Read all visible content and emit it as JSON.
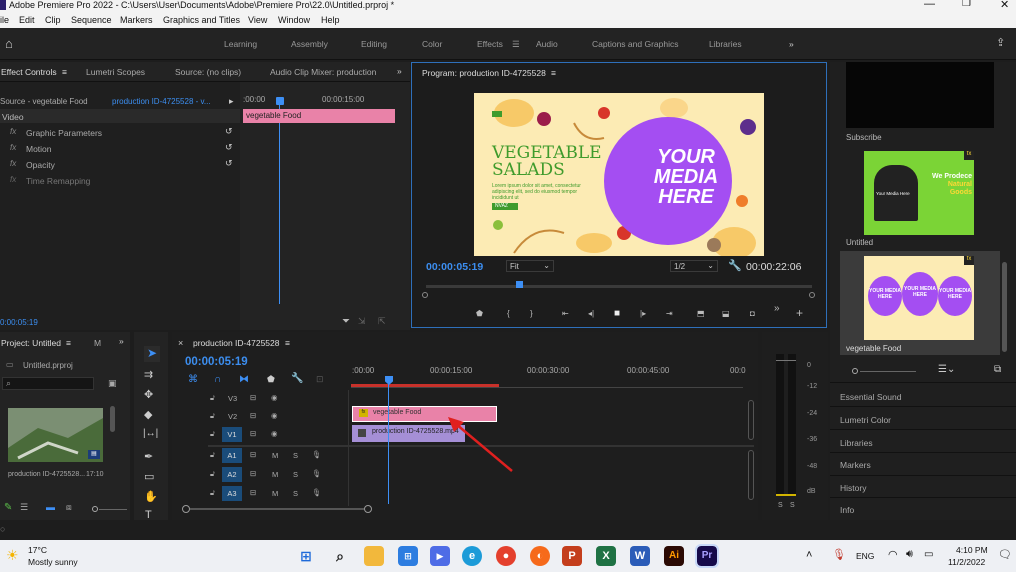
{
  "window": {
    "title": "Adobe Premiere Pro 2022 - C:\\Users\\User\\Documents\\Adobe\\Premiere Pro\\22.0\\Untitled.prproj *"
  },
  "menu": [
    "ile",
    "Edit",
    "Clip",
    "Sequence",
    "Markers",
    "Graphics and Titles",
    "View",
    "Window",
    "Help"
  ],
  "workspaces": [
    "Learning",
    "Assembly",
    "Editing",
    "Color",
    "Effects",
    "Audio",
    "Captions and Graphics",
    "Libraries"
  ],
  "active_workspace": "Effects",
  "effect_controls": {
    "tabs": [
      "Effect Controls",
      "Lumetri Scopes",
      "Source: (no clips)",
      "Audio Clip Mixer: production"
    ],
    "source": "Source - vegetable Food",
    "sequence": "production ID-4725528 - v...",
    "video_label": "Video",
    "effects": [
      "Graphic Parameters",
      "Motion",
      "Opacity",
      "Time Remapping"
    ],
    "times": [
      ":00:00",
      "00:00:15:00"
    ],
    "clip_label": "vegetable Food",
    "current_time": "0:00:05:19"
  },
  "program": {
    "title": "Program: production ID-4725528",
    "timecode": "00:00:05:19",
    "fit": "Fit",
    "resolution": "1/2",
    "duration": "00:00:22:06",
    "preview": {
      "headline1": "VEGETABLE",
      "headline2": "SALADS",
      "body": "Lorem ipsum dolor sit amet, consectetur adipiscing elit, sed do eiusmod tempor incididunt ut",
      "cta": "NVAZ",
      "media": [
        "YOUR",
        "MEDIA",
        "HERE"
      ]
    }
  },
  "templates": {
    "items": [
      "Subscribe",
      "Untitled",
      "vegetable Food"
    ],
    "thumb2_text": [
      "We Prodece",
      "Natural",
      "Goods"
    ],
    "thumb2_sub": "Your Media Here",
    "thumb3_bubbles": [
      "YOUR MEDIA HERE",
      "YOUR MEDIA HERE",
      "YOUR MEDIA HERE"
    ],
    "panels": [
      "Essential Sound",
      "Lumetri Color",
      "Libraries",
      "Markers",
      "History",
      "Info"
    ]
  },
  "project": {
    "title": "Project: Untitled",
    "m": "M",
    "file": "Untitled.prproj",
    "clip_name": "production ID-4725528...",
    "clip_duration": "17:10"
  },
  "timeline": {
    "title": "production ID-4725528",
    "timecode": "00:00:05:19",
    "ruler": [
      ":00:00",
      "00:00:15:00",
      "00:00:30:00",
      "00:00:45:00",
      "00:0"
    ],
    "tracks": [
      "V3",
      "V2",
      "V1",
      "A1",
      "A2",
      "A3"
    ],
    "clips": {
      "graphic": "vegetable Food",
      "video": "production ID-4725528.mp4"
    },
    "track_toggles": {
      "mute": "M",
      "solo": "S"
    }
  },
  "meter": {
    "scale": [
      "0",
      "-12",
      "-24",
      "-36",
      "-48",
      "dB"
    ],
    "solo": [
      "S",
      "S"
    ]
  },
  "taskbar": {
    "temp": "17°C",
    "weather": "Mostly sunny",
    "lang": "ENG",
    "time": "4:10 PM",
    "date": "11/2/2022"
  },
  "colors": {
    "accent": "#2e8bff",
    "clip_pink": "#e982a8",
    "clip_purple": "#a58fd6",
    "playhead": "#3d8ff5"
  }
}
